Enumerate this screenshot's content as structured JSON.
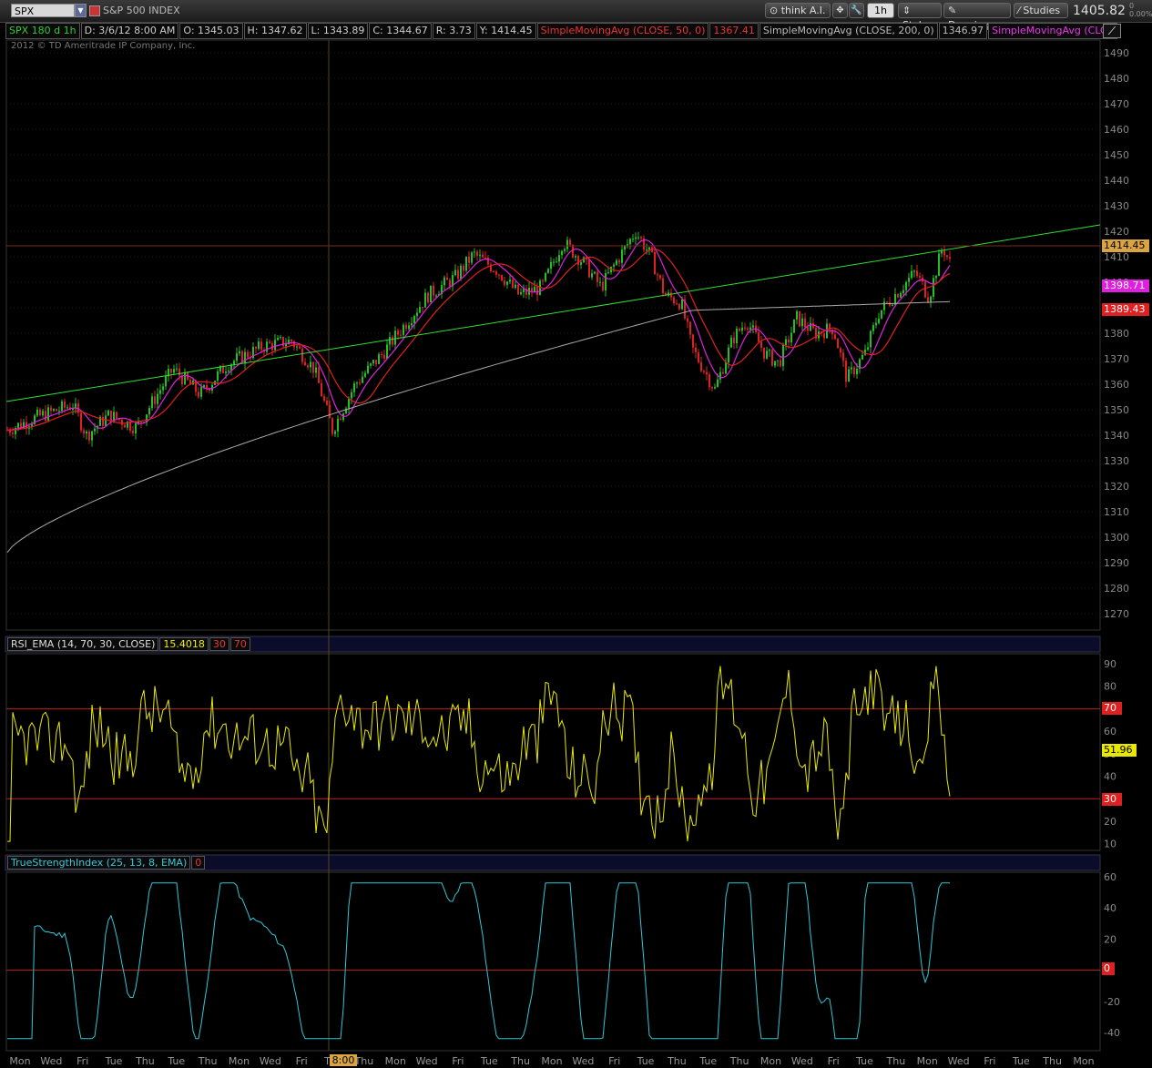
{
  "header": {
    "symbol": "SPX",
    "index_name": "S&P 500 INDEX",
    "think_ai": "think A.I.",
    "interval": "1h",
    "style": "Style",
    "drawings": "Drawings",
    "studies": "Studies",
    "last_price": "1405.82",
    "change_line1": "0",
    "change_line2": "0.00%"
  },
  "infobar": {
    "chart_id": "SPX 180 d 1h",
    "date": "D: 3/6/12 8:00 AM",
    "open": "O: 1345.03",
    "high": "H: 1347.62",
    "low": "L: 1343.89",
    "close": "C: 1344.67",
    "range": "R: 3.73",
    "y": "Y: 1414.45",
    "sma50": "SimpleMovingAvg (CLOSE, 50, 0)",
    "sma50_val": "1367.41",
    "sma200": "SimpleMovingAvg (CLOSE, 200, 0)",
    "sma200_val": "1346.97",
    "sma_other": "SimpleMovingAvg (CLOSE,..."
  },
  "copyright": "2012 © TD Ameritrade IP Company, Inc.",
  "price_axis": {
    "ticks": [
      "1490",
      "1480",
      "1470",
      "1460",
      "1450",
      "1440",
      "1430",
      "1420",
      "1410",
      "1400",
      "1390",
      "1380",
      "1370",
      "1360",
      "1350",
      "1340",
      "1330",
      "1320",
      "1310",
      "1300",
      "1290",
      "1280",
      "1270"
    ],
    "badge_cursor": "1414.45",
    "badge_magenta": "1398.71",
    "badge_red": "1389.43"
  },
  "rsi": {
    "label": "RSI_EMA (14, 70, 30, CLOSE)",
    "value": "15.4018",
    "os": "30",
    "ob": "70",
    "ticks": [
      "90",
      "80",
      "70",
      "60",
      "50",
      "40",
      "30",
      "20",
      "10"
    ],
    "badge_value": "51.96",
    "badge_70": "70",
    "badge_30": "30"
  },
  "tsi": {
    "label": "TrueStrengthIndex (25, 13, 8, EMA)",
    "value": "0",
    "ticks": [
      "60",
      "40",
      "20",
      "0",
      "-20",
      "-40"
    ],
    "badge_zero": "0"
  },
  "time_axis": {
    "labels": [
      "Mon",
      "Wed",
      "Fri",
      "Tue",
      "Thu",
      "Tue",
      "Thu",
      "Mon",
      "Wed",
      "Fri",
      "Tue",
      "Thu",
      "Mon",
      "Wed",
      "Fri",
      "Tue",
      "Thu",
      "Mon",
      "Wed",
      "Fri",
      "Tue",
      "Thu",
      "Tue",
      "Thu",
      "Mon",
      "Wed",
      "Fri",
      "Tue",
      "Thu",
      "Mon",
      "Wed",
      "Fri",
      "Tue",
      "Thu",
      "Mon"
    ],
    "cursor_time": "8:00"
  },
  "colors": {
    "up": "#22c022",
    "down": "#e02020",
    "sma_red": "#e02020",
    "sma_magenta": "#e020e0",
    "sma_white": "#aaaaaa",
    "trendline": "#33dd33",
    "rsi": "#e8e800",
    "tsi": "#30c8d8"
  }
}
